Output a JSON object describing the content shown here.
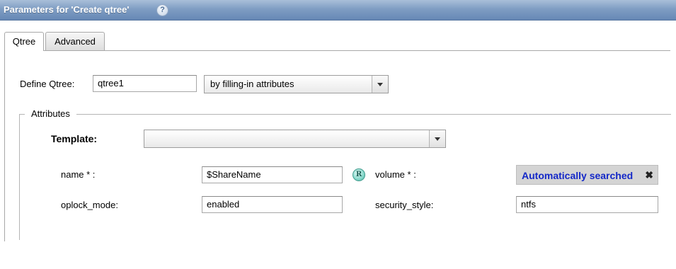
{
  "header": {
    "title": "Parameters for 'Create qtree'",
    "help_icon": "help-icon"
  },
  "tabs": [
    {
      "label": "Qtree",
      "active": true
    },
    {
      "label": "Advanced",
      "active": false
    }
  ],
  "define": {
    "label": "Define Qtree:",
    "value": "qtree1",
    "mode": "by filling-in attributes"
  },
  "attributes": {
    "legend": "Attributes",
    "template_label": "Template:",
    "template_value": "",
    "fields": {
      "name": {
        "label": "name * :",
        "value": "$ShareName"
      },
      "volume": {
        "label": "volume * :",
        "value": "Automatically searched",
        "clear_glyph": "✖"
      },
      "oplock_mode": {
        "label": "oplock_mode:",
        "value": "enabled"
      },
      "security_style": {
        "label": "security_style:",
        "value": "ntfs"
      }
    },
    "resolve_badge": "R"
  },
  "colors": {
    "title_bar": "#7f9dc3",
    "auto_text": "#1428c8"
  }
}
